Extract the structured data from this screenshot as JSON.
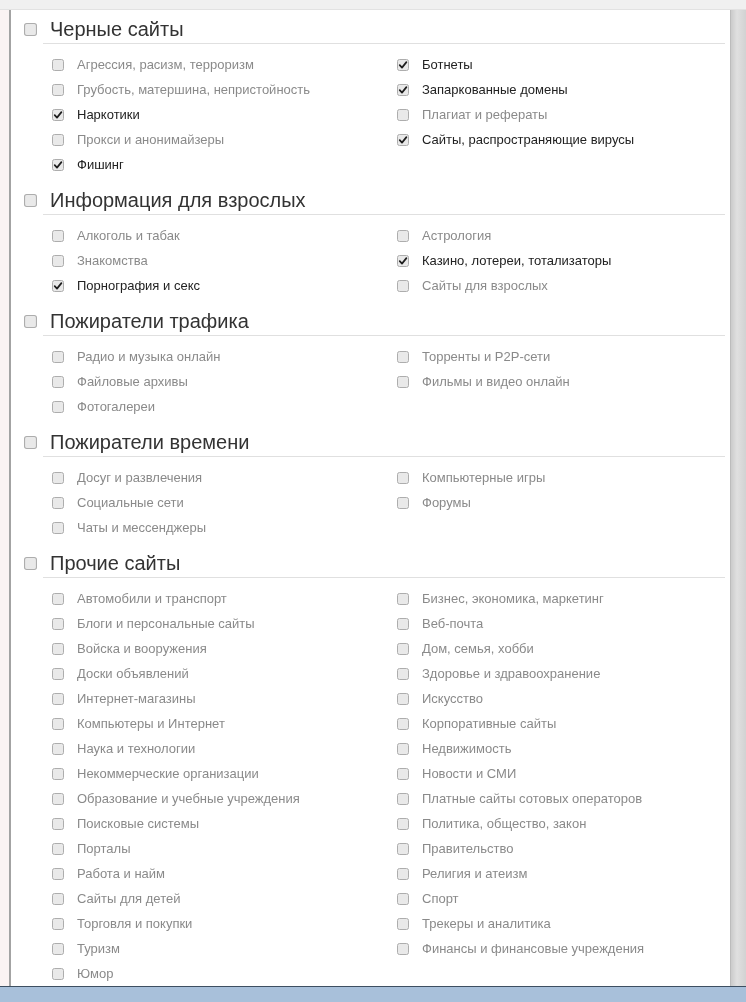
{
  "sections": [
    {
      "title": "Черные сайты",
      "checked": false,
      "items": [
        {
          "label": "Агрессия, расизм, терроризм",
          "checked": false
        },
        {
          "label": "Ботнеты",
          "checked": true
        },
        {
          "label": "Грубость, матершина, непристойность",
          "checked": false
        },
        {
          "label": "Запаркованные домены",
          "checked": true
        },
        {
          "label": "Наркотики",
          "checked": true
        },
        {
          "label": "Плагиат и рефераты",
          "checked": false
        },
        {
          "label": "Прокси и анонимайзеры",
          "checked": false
        },
        {
          "label": "Сайты, распространяющие вирусы",
          "checked": true
        },
        {
          "label": "Фишинг",
          "checked": true
        }
      ]
    },
    {
      "title": "Информация для взрослых",
      "checked": false,
      "items": [
        {
          "label": "Алкоголь и табак",
          "checked": false
        },
        {
          "label": "Астрология",
          "checked": false
        },
        {
          "label": "Знакомства",
          "checked": false
        },
        {
          "label": "Казино, лотереи, тотализаторы",
          "checked": true
        },
        {
          "label": "Порнография и секс",
          "checked": true
        },
        {
          "label": "Сайты для взрослых",
          "checked": false
        }
      ]
    },
    {
      "title": "Пожиратели трафика",
      "checked": false,
      "items": [
        {
          "label": "Радио и музыка онлайн",
          "checked": false
        },
        {
          "label": "Торренты и P2P-сети",
          "checked": false
        },
        {
          "label": "Файловые архивы",
          "checked": false
        },
        {
          "label": "Фильмы и видео онлайн",
          "checked": false
        },
        {
          "label": "Фотогалереи",
          "checked": false
        }
      ]
    },
    {
      "title": "Пожиратели времени",
      "checked": false,
      "items": [
        {
          "label": "Досуг и развлечения",
          "checked": false
        },
        {
          "label": "Компьютерные игры",
          "checked": false
        },
        {
          "label": "Социальные сети",
          "checked": false
        },
        {
          "label": "Форумы",
          "checked": false
        },
        {
          "label": "Чаты и мессенджеры",
          "checked": false
        }
      ]
    },
    {
      "title": "Прочие сайты",
      "checked": false,
      "items": [
        {
          "label": "Автомобили и транспорт",
          "checked": false
        },
        {
          "label": "Бизнес, экономика, маркетинг",
          "checked": false
        },
        {
          "label": "Блоги и персональные сайты",
          "checked": false
        },
        {
          "label": "Веб-почта",
          "checked": false
        },
        {
          "label": "Войска и вооружения",
          "checked": false
        },
        {
          "label": "Дом, семья, хобби",
          "checked": false
        },
        {
          "label": "Доски объявлений",
          "checked": false
        },
        {
          "label": "Здоровье и здравоохранение",
          "checked": false
        },
        {
          "label": "Интернет-магазины",
          "checked": false
        },
        {
          "label": "Искусство",
          "checked": false
        },
        {
          "label": "Компьютеры и Интернет",
          "checked": false
        },
        {
          "label": "Корпоративные сайты",
          "checked": false
        },
        {
          "label": "Наука и технологии",
          "checked": false
        },
        {
          "label": "Недвижимость",
          "checked": false
        },
        {
          "label": "Некоммерческие организации",
          "checked": false
        },
        {
          "label": "Новости и СМИ",
          "checked": false
        },
        {
          "label": "Образование и учебные учреждения",
          "checked": false
        },
        {
          "label": "Платные сайты сотовых операторов",
          "checked": false
        },
        {
          "label": "Поисковые системы",
          "checked": false
        },
        {
          "label": "Политика, общество, закон",
          "checked": false
        },
        {
          "label": "Порталы",
          "checked": false
        },
        {
          "label": "Правительство",
          "checked": false
        },
        {
          "label": "Работа и найм",
          "checked": false
        },
        {
          "label": "Религия и атеизм",
          "checked": false
        },
        {
          "label": "Сайты для детей",
          "checked": false
        },
        {
          "label": "Спорт",
          "checked": false
        },
        {
          "label": "Торговля и покупки",
          "checked": false
        },
        {
          "label": "Трекеры и аналитика",
          "checked": false
        },
        {
          "label": "Туризм",
          "checked": false
        },
        {
          "label": "Финансы и финансовые учреждения",
          "checked": false
        },
        {
          "label": "Юмор",
          "checked": false
        }
      ]
    }
  ]
}
